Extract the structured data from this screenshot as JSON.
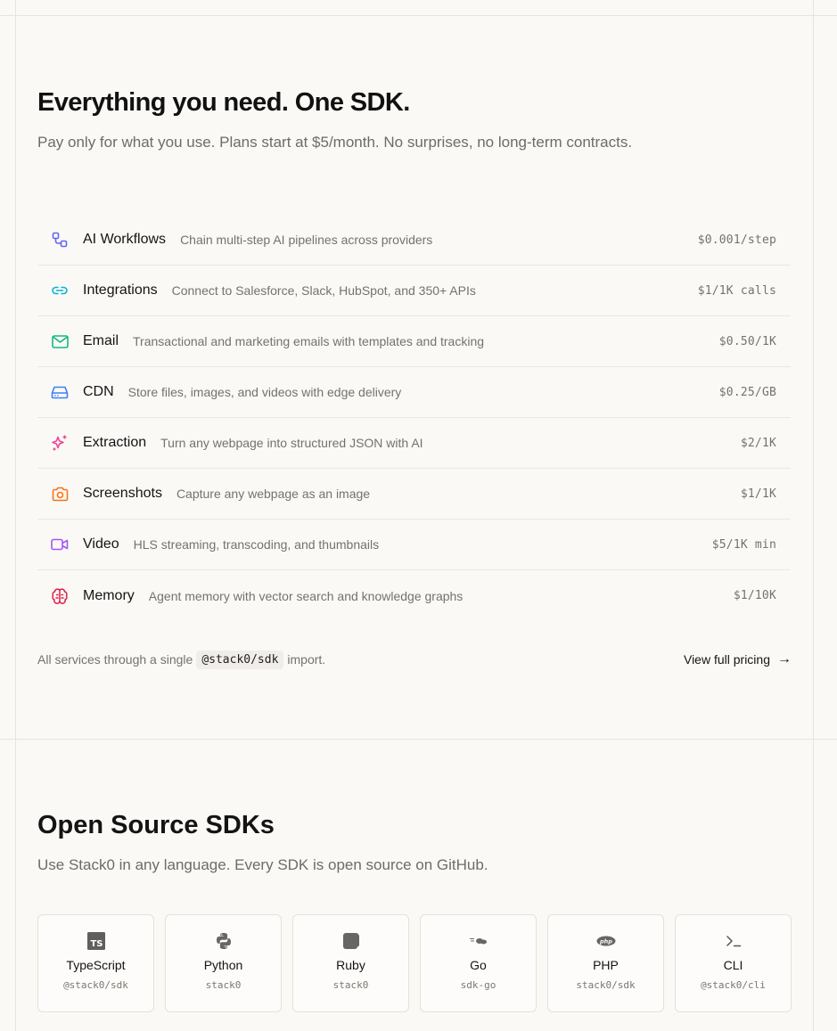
{
  "pricing": {
    "title": "Everything you need. One SDK.",
    "subtitle": "Pay only for what you use. Plans start at $5/month. No surprises, no long-term contracts.",
    "services": [
      {
        "name": "AI Workflows",
        "desc": "Chain multi-step AI pipelines across providers",
        "price": "$0.001/step",
        "icon": "workflow-icon",
        "color": "#6366f1"
      },
      {
        "name": "Integrations",
        "desc": "Connect to Salesforce, Slack, HubSpot, and 350+ APIs",
        "price": "$1/1K calls",
        "icon": "link-icon",
        "color": "#06b6d4"
      },
      {
        "name": "Email",
        "desc": "Transactional and marketing emails with templates and tracking",
        "price": "$0.50/1K",
        "icon": "mail-icon",
        "color": "#10b981"
      },
      {
        "name": "CDN",
        "desc": "Store files, images, and videos with edge delivery",
        "price": "$0.25/GB",
        "icon": "hard-drive-icon",
        "color": "#3b82f6"
      },
      {
        "name": "Extraction",
        "desc": "Turn any webpage into structured JSON with AI",
        "price": "$2/1K",
        "icon": "sparkles-icon",
        "color": "#ec4899"
      },
      {
        "name": "Screenshots",
        "desc": "Capture any webpage as an image",
        "price": "$1/1K",
        "icon": "camera-icon",
        "color": "#f97316"
      },
      {
        "name": "Video",
        "desc": "HLS streaming, transcoding, and thumbnails",
        "price": "$5/1K min",
        "icon": "video-icon",
        "color": "#a855f7"
      },
      {
        "name": "Memory",
        "desc": "Agent memory with vector search and knowledge graphs",
        "price": "$1/10K",
        "icon": "brain-icon",
        "color": "#e11d48"
      }
    ],
    "footer_prefix": "All services through a single",
    "footer_code": "@stack0/sdk",
    "footer_suffix": "import.",
    "pricing_link": "View full pricing",
    "pricing_arrow": "→"
  },
  "sdks": {
    "title": "Open Source SDKs",
    "subtitle": "Use Stack0 in any language. Every SDK is open source on GitHub.",
    "items": [
      {
        "name": "TypeScript",
        "pkg": "@stack0/sdk",
        "icon": "typescript-icon",
        "badge": "TS"
      },
      {
        "name": "Python",
        "pkg": "stack0",
        "icon": "python-icon"
      },
      {
        "name": "Ruby",
        "pkg": "stack0",
        "icon": "ruby-icon"
      },
      {
        "name": "Go",
        "pkg": "sdk-go",
        "icon": "go-icon"
      },
      {
        "name": "PHP",
        "pkg": "stack0/sdk",
        "icon": "php-icon",
        "badge": "php"
      },
      {
        "name": "CLI",
        "pkg": "@stack0/cli",
        "icon": "terminal-icon"
      }
    ]
  }
}
